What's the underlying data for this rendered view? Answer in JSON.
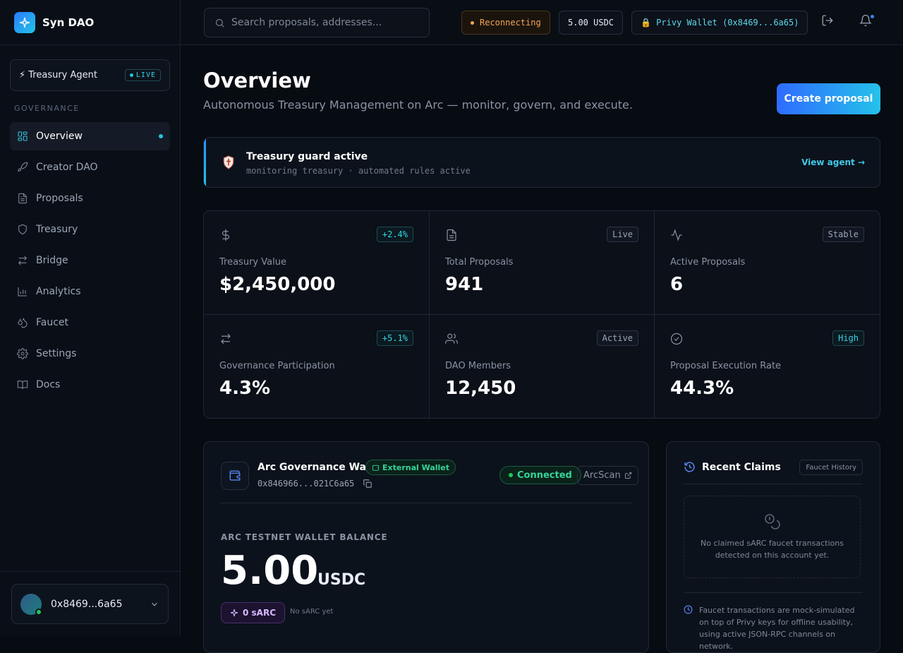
{
  "brand": {
    "name": "Syn DAO"
  },
  "agent": {
    "label": "⚡ Treasury Agent",
    "live": "LIVE"
  },
  "sidebar": {
    "section_title": "GOVERNANCE",
    "items": [
      {
        "label": "Overview",
        "icon": "grid-icon",
        "active": true
      },
      {
        "label": "Creator DAO",
        "icon": "rocket-icon"
      },
      {
        "label": "Proposals",
        "icon": "document-icon"
      },
      {
        "label": "Treasury",
        "icon": "shield-icon"
      },
      {
        "label": "Bridge",
        "icon": "swap-icon"
      },
      {
        "label": "Analytics",
        "icon": "bar-chart-icon"
      },
      {
        "label": "Faucet",
        "icon": "droplet-icon"
      },
      {
        "label": "Settings",
        "icon": "gear-icon"
      },
      {
        "label": "Docs",
        "icon": "book-icon"
      }
    ],
    "user_address": "0x8469...6a65"
  },
  "topbar": {
    "search_placeholder": "Search proposals, addresses...",
    "status": "Reconnecting",
    "balance": "5.00 USDC",
    "wallet": "🔒 Privy Wallet (0x8469...6a65)"
  },
  "header": {
    "title": "Overview",
    "subtitle": "Autonomous Treasury Management on Arc — monitor, govern, and execute.",
    "create_button": "Create proposal"
  },
  "guard": {
    "title": "Treasury guard active",
    "subtitle": "monitoring treasury · automated rules active",
    "link": "View agent →"
  },
  "stats": [
    {
      "label": "Treasury Value",
      "value": "$2,450,000",
      "badge": "+2.4%",
      "icon": "dollar-icon"
    },
    {
      "label": "Total Proposals",
      "value": "941",
      "badge": "Live",
      "icon": "document-icon"
    },
    {
      "label": "Active Proposals",
      "value": "6",
      "badge": "Stable",
      "icon": "activity-icon"
    },
    {
      "label": "Governance Participation",
      "value": "4.3%",
      "badge": "+5.1%",
      "icon": "swap-icon"
    },
    {
      "label": "DAO Members",
      "value": "12,450",
      "badge": "Active",
      "icon": "users-icon"
    },
    {
      "label": "Proposal Execution Rate",
      "value": "44.3%",
      "badge": "High",
      "icon": "check-circle-icon"
    }
  ],
  "wallet_card": {
    "title": "Arc Governance Wallet",
    "tag": "External Wallet",
    "address": "0x846966...021C6a65",
    "status": "Connected",
    "explorer": "ArcScan",
    "caption": "ARC TESTNET WALLET BALANCE",
    "balance": "5.00",
    "unit": "USDC",
    "sarc": "0 sARC",
    "sarc_note": "No sARC yet"
  },
  "claims": {
    "title": "Recent Claims",
    "tag": "Faucet History",
    "empty": "No claimed sARC faucet transactions detected on this account yet.",
    "note": "Faucet transactions are mock-simulated on top of Privy keys for offline usability, using active JSON-RPC channels on network."
  }
}
